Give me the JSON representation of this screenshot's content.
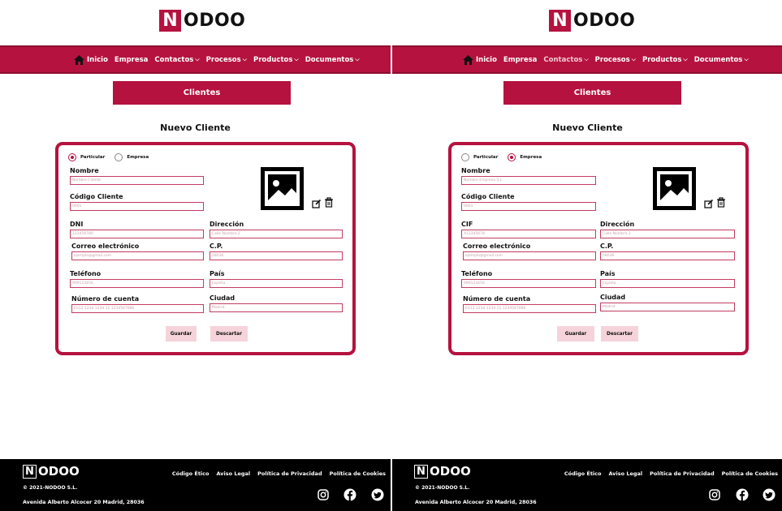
{
  "brand": {
    "logo_initial": "N",
    "logo_rest": "ODOO",
    "accent_color": "#b5123f"
  },
  "nav": {
    "items": [
      {
        "label": "Inicio",
        "icon": "home-icon"
      },
      {
        "label": "Empresa"
      },
      {
        "label": "Contactos",
        "dropdown": true
      },
      {
        "label": "Procesos",
        "dropdown": true
      },
      {
        "label": "Productos",
        "dropdown": true
      },
      {
        "label": "Documentos",
        "dropdown": true
      }
    ]
  },
  "section_button": "Clientes",
  "form_title": "Nuevo Cliente",
  "left": {
    "radio": {
      "particular": "Particular",
      "empresa": "Empresa",
      "selected": "Particular"
    },
    "nombre": {
      "label": "Nombre",
      "placeholder": "Nombre Cliente"
    },
    "codigo": {
      "label": "Código Cliente",
      "placeholder": "0001"
    },
    "id_field": {
      "label": "DNI",
      "placeholder": "12345678R"
    },
    "direccion": {
      "label": "Dirección",
      "placeholder": "Calle Nombre 2"
    },
    "correo": {
      "label": "Correo electrónico",
      "placeholder": "ejemplo@gmail.com"
    },
    "cp": {
      "label": "C.P.",
      "placeholder": "28036"
    },
    "telefono": {
      "label": "Teléfono",
      "placeholder": "999123456"
    },
    "pais": {
      "label": "País",
      "placeholder": "España"
    },
    "cuenta": {
      "label": "Número de cuenta",
      "placeholder": "ES12 1234 1234 12 1234567890"
    },
    "ciudad": {
      "label": "Ciudad",
      "placeholder": "Madrid"
    }
  },
  "right": {
    "radio": {
      "particular": "Particular",
      "empresa": "Empresa",
      "selected": "Empresa"
    },
    "nombre": {
      "label": "Nombre",
      "placeholder": "Nombre Empresa S.L."
    },
    "codigo": {
      "label": "Código Cliente",
      "placeholder": "0001"
    },
    "id_field": {
      "label": "CIF",
      "placeholder": "A12345678"
    },
    "direccion": {
      "label": "Dirección",
      "placeholder": "Calle Nombre 2"
    },
    "correo": {
      "label": "Correo electrónico",
      "placeholder": "ejemplo@gmail.com"
    },
    "cp": {
      "label": "C.P.",
      "placeholder": "28036"
    },
    "telefono": {
      "label": "Teléfono",
      "placeholder": "999123456"
    },
    "pais": {
      "label": "País",
      "placeholder": "España"
    },
    "cuenta": {
      "label": "Número de cuenta",
      "placeholder": "ES12 1234 1234 12 1234567890"
    },
    "ciudad": {
      "label": "Ciudad",
      "placeholder": "Madrid"
    }
  },
  "buttons": {
    "save": "Guardar",
    "discard": "Descartar"
  },
  "footer": {
    "links": [
      "Código Ético",
      "Aviso Legal",
      "Política de Privacidad",
      "Política de Cookies"
    ],
    "copyright": "© 2021-NODOO S.L.",
    "address": "Avenida Alberto Alcocer 20 Madrid, 28036",
    "social": [
      "instagram-icon",
      "facebook-icon",
      "twitter-icon"
    ]
  }
}
